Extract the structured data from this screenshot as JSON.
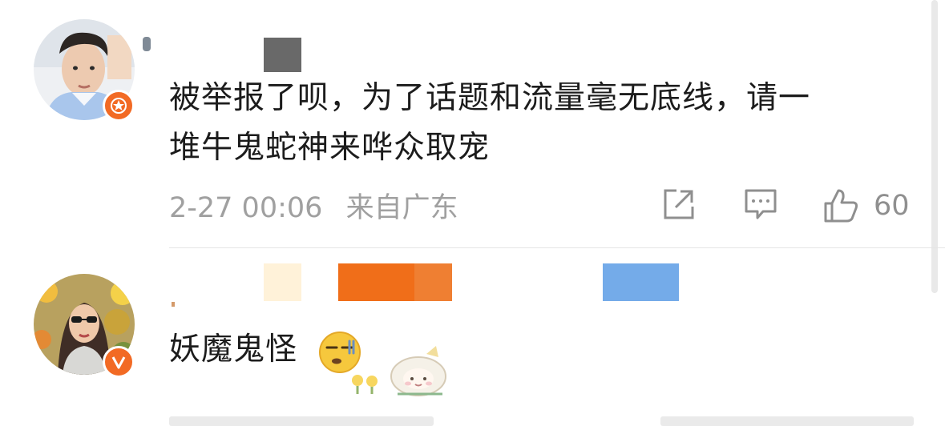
{
  "comments": [
    {
      "text_line1": "被举报了呗，为了话题和流量毫无底线，请一",
      "text_line2": "堆牛鬼蛇神来哗众取宠",
      "time": "2-27 00:06",
      "location": "来自广东",
      "likes": "60"
    },
    {
      "text": "妖魔鬼怪"
    }
  ],
  "icons": {
    "share": "share-icon",
    "reply": "comment-icon",
    "like": "thumbs-up-icon",
    "badge": "verified-badge-icon",
    "emoji": "smirk-emoji-icon",
    "sticker": "sheep-sticker-icon"
  },
  "colors": {
    "badge_orange": "#f26a24",
    "meta_gray": "#a0a0a0",
    "text_dark": "#1c1c1c"
  }
}
